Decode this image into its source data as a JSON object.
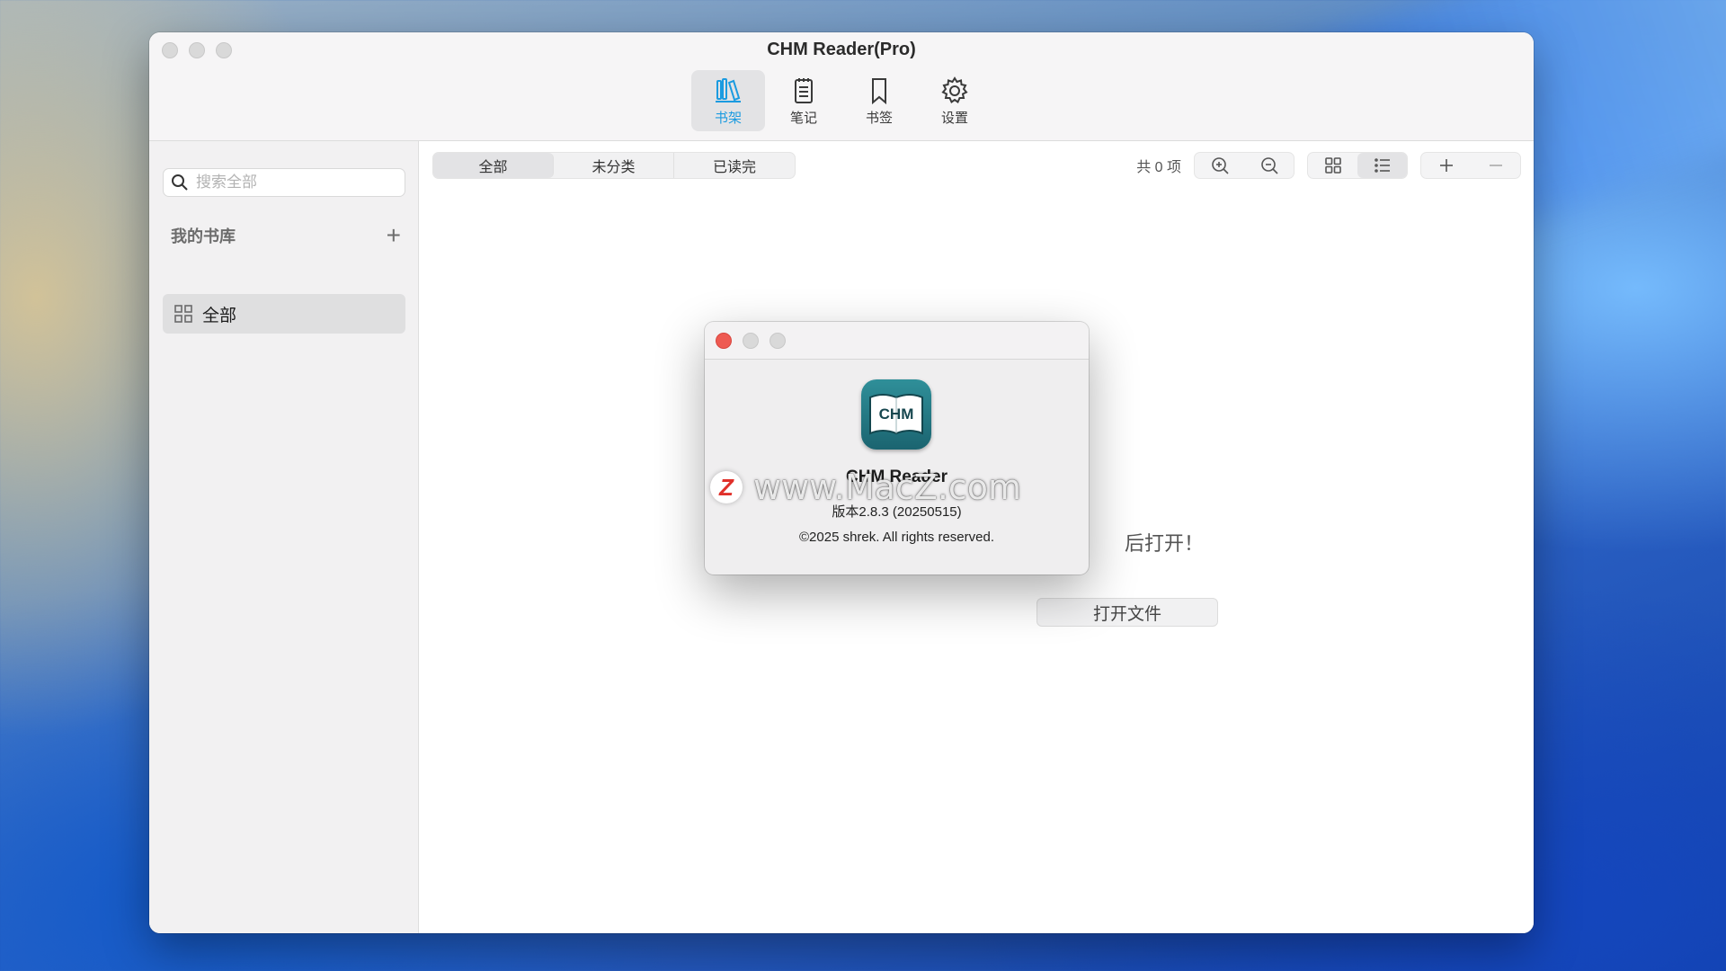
{
  "window": {
    "title": "CHM Reader(Pro)"
  },
  "toolbar": {
    "items": [
      {
        "label": "书架",
        "icon": "bookshelf-icon",
        "active": true
      },
      {
        "label": "笔记",
        "icon": "notes-icon",
        "active": false
      },
      {
        "label": "书签",
        "icon": "bookmark-icon",
        "active": false
      },
      {
        "label": "设置",
        "icon": "gear-icon",
        "active": false
      }
    ]
  },
  "sidebar": {
    "search_placeholder": "搜索全部",
    "library_title": "我的书库",
    "add_symbol": "+",
    "items": [
      {
        "label": "全部",
        "icon": "grid-icon",
        "selected": true
      }
    ]
  },
  "main": {
    "filter_tabs": [
      "全部",
      "未分类",
      "已读完"
    ],
    "selected_tab": "全部",
    "count_label": "共 0 项",
    "empty_message_partial": "后打开！",
    "open_button": "打开文件"
  },
  "about": {
    "icon_text": "CHM",
    "app_name": "CHM Reader",
    "version": "版本2.8.3 (20250515)",
    "copyright": "©2025 shrek. All rights reserved."
  },
  "watermark": {
    "logo": "Z",
    "text": "www.MacZ.com"
  },
  "colors": {
    "accent": "#1b9be0",
    "close_red": "#ee5a52",
    "icon_teal": "#1b6470"
  }
}
